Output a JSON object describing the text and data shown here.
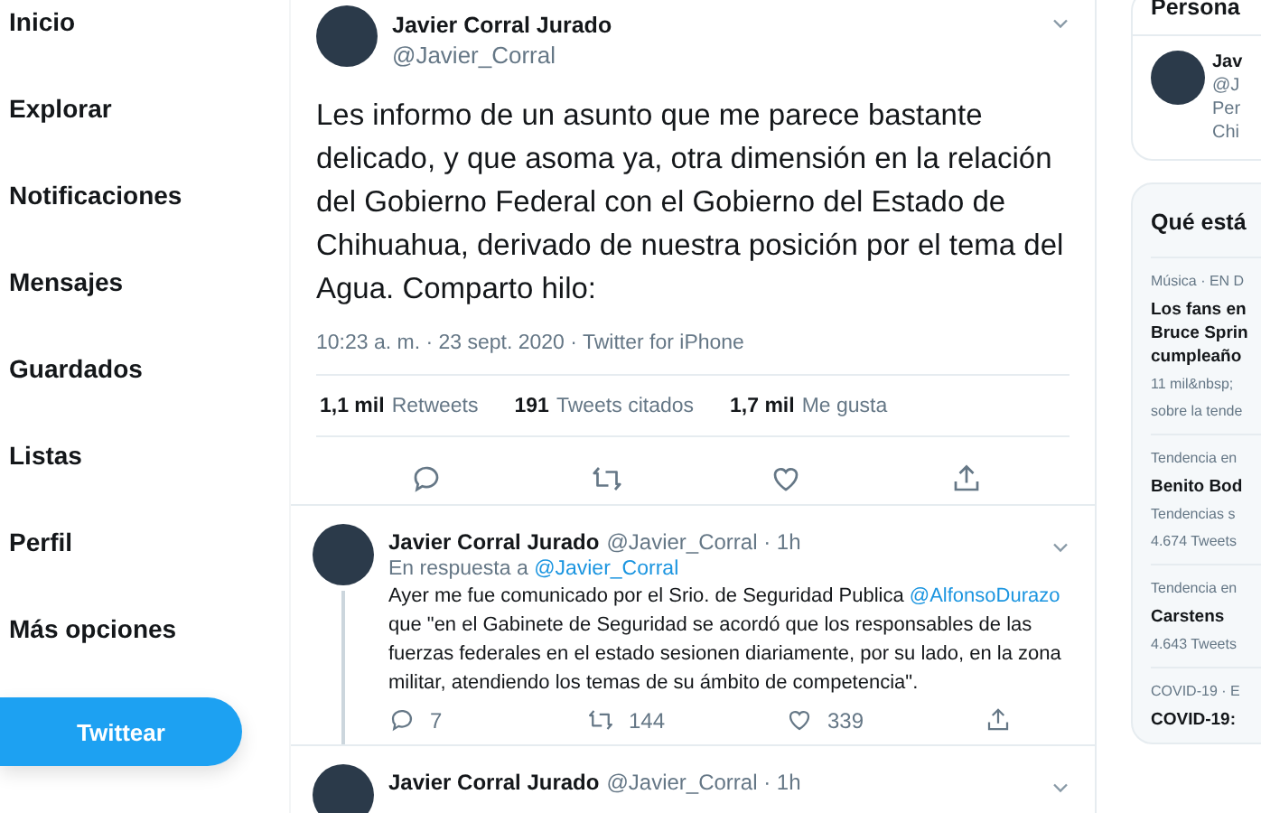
{
  "nav": {
    "items": [
      {
        "label": "Inicio"
      },
      {
        "label": "Explorar"
      },
      {
        "label": "Notificaciones"
      },
      {
        "label": "Mensajes"
      },
      {
        "label": "Guardados"
      },
      {
        "label": "Listas"
      },
      {
        "label": "Perfil"
      },
      {
        "label": "Más opciones"
      }
    ],
    "tweet_button": "Twittear"
  },
  "main_tweet": {
    "name": "Javier Corral Jurado",
    "handle": "@Javier_Corral",
    "text": "Les informo de un asunto que me parece bastante delicado, y que asoma ya, otra dimensión en la relación del Gobierno Federal con el Gobierno del Estado de Chihuahua, derivado de nuestra posición por el tema del Agua. Comparto hilo:",
    "meta": "10:23 a. m. · 23 sept. 2020 · Twitter for iPhone",
    "stats": [
      {
        "count": "1,1 mil",
        "label": "Retweets"
      },
      {
        "count": "191",
        "label": "Tweets citados"
      },
      {
        "count": "1,7 mil",
        "label": "Me gusta"
      }
    ]
  },
  "replies": [
    {
      "name": "Javier Corral Jurado",
      "handle": "@Javier_Corral · 1h",
      "reply_prefix": "En respuesta a",
      "reply_to": "@Javier_Corral",
      "body": [
        {
          "kind": "text",
          "text": "Ayer me fue comunicado por el Srio. de Seguridad Publica "
        },
        {
          "kind": "mention",
          "text": "@AlfonsoDurazo"
        },
        {
          "kind": "text",
          "text": " que \"en el Gabinete de Seguridad se acordó que los responsables de las fuerzas federales en el estado sesionen diariamente, por su lado, en la zona militar, atendiendo los temas de su ámbito de competencia\"."
        }
      ],
      "counts": {
        "replies": "7",
        "retweets": "144",
        "likes": "339"
      }
    },
    {
      "name": "Javier Corral Jurado",
      "handle": "@Javier_Corral · 1h"
    }
  ],
  "sidebar": {
    "people_title": "Persona",
    "person": {
      "name": "Jav",
      "handle": "@J",
      "bio": [
        "Per",
        "Chi"
      ]
    },
    "trends_title": "Qué está",
    "trends": [
      {
        "context": "Música · EN D",
        "title": [
          "Los fans en",
          "Bruce Sprin",
          "cumpleaño"
        ],
        "extra": [
          "11 mil&nbsp;",
          "sobre la tende"
        ]
      },
      {
        "context": "Tendencia en",
        "title": [
          "Benito Bod"
        ],
        "extra": [
          "Tendencias s",
          "4.674 Tweets"
        ]
      },
      {
        "context": "Tendencia en",
        "title": [
          "Carstens"
        ],
        "extra": [
          "4.643 Tweets"
        ]
      },
      {
        "context": "COVID-19 · E",
        "title": [
          "COVID-19:"
        ]
      }
    ]
  }
}
